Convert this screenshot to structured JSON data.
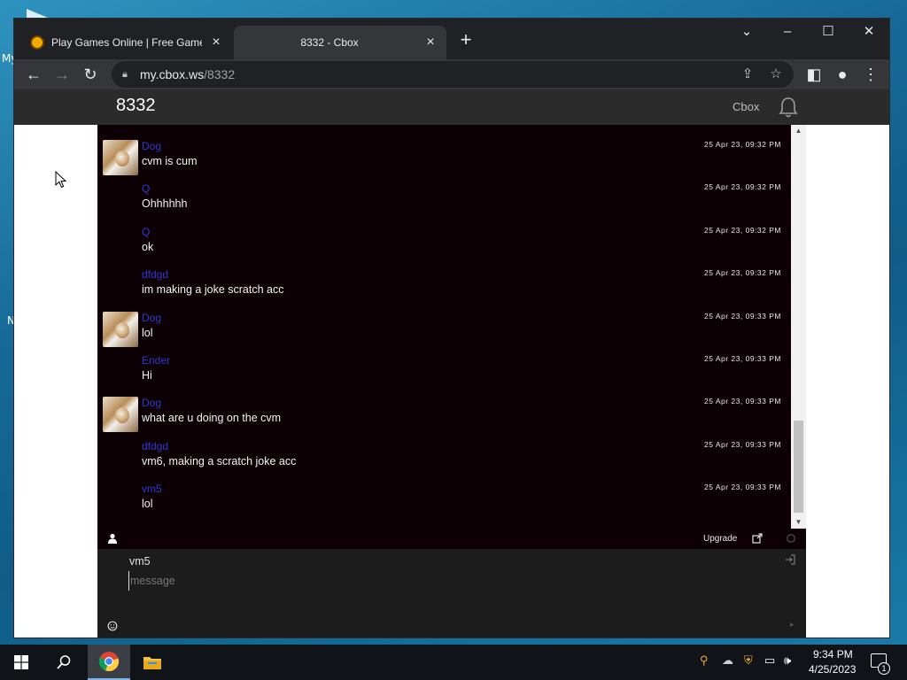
{
  "desktop": {
    "icon_labels": [
      "My",
      "N"
    ]
  },
  "browser": {
    "tabs": [
      {
        "title": "Play Games Online | Free Games",
        "active": false
      },
      {
        "title": "8332 - Cbox",
        "active": true
      }
    ],
    "address": {
      "host": "my.cbox.ws",
      "path": "/8332"
    }
  },
  "site": {
    "title": "8332",
    "brand": "Cbox"
  },
  "messages": [
    {
      "user": "Dog",
      "text": "cvm is cum",
      "time": "25 Apr 23, 09:32 PM",
      "avatar": true
    },
    {
      "user": "Q",
      "text": "Ohhhhhh",
      "time": "25 Apr 23, 09:32 PM",
      "avatar": false
    },
    {
      "user": "Q",
      "text": "ok",
      "time": "25 Apr 23, 09:32 PM",
      "avatar": false
    },
    {
      "user": "dfdgd",
      "text": "im making a joke scratch acc",
      "time": "25 Apr 23, 09:32 PM",
      "avatar": false
    },
    {
      "user": "Dog",
      "text": "lol",
      "time": "25 Apr 23, 09:33 PM",
      "avatar": true
    },
    {
      "user": "Ender",
      "text": "Hi",
      "time": "25 Apr 23, 09:33 PM",
      "avatar": false
    },
    {
      "user": "Dog",
      "text": "what are u doing on the cvm",
      "time": "25 Apr 23, 09:33 PM",
      "avatar": true
    },
    {
      "user": "dfdgd",
      "text": "vm6, making a scratch joke acc",
      "time": "25 Apr 23, 09:33 PM",
      "avatar": false
    },
    {
      "user": "vm5",
      "text": "lol",
      "time": "25 Apr 23, 09:33 PM",
      "avatar": false
    }
  ],
  "chatbar": {
    "upgrade_label": "Upgrade"
  },
  "compose": {
    "name": "vm5",
    "placeholder": "message"
  },
  "taskbar": {
    "time": "9:34 PM",
    "date": "4/25/2023",
    "notification_count": "1"
  },
  "colors": {
    "chat_bg": "#0d0004",
    "username": "#3535d6",
    "site_bar": "#2b2b2b"
  }
}
